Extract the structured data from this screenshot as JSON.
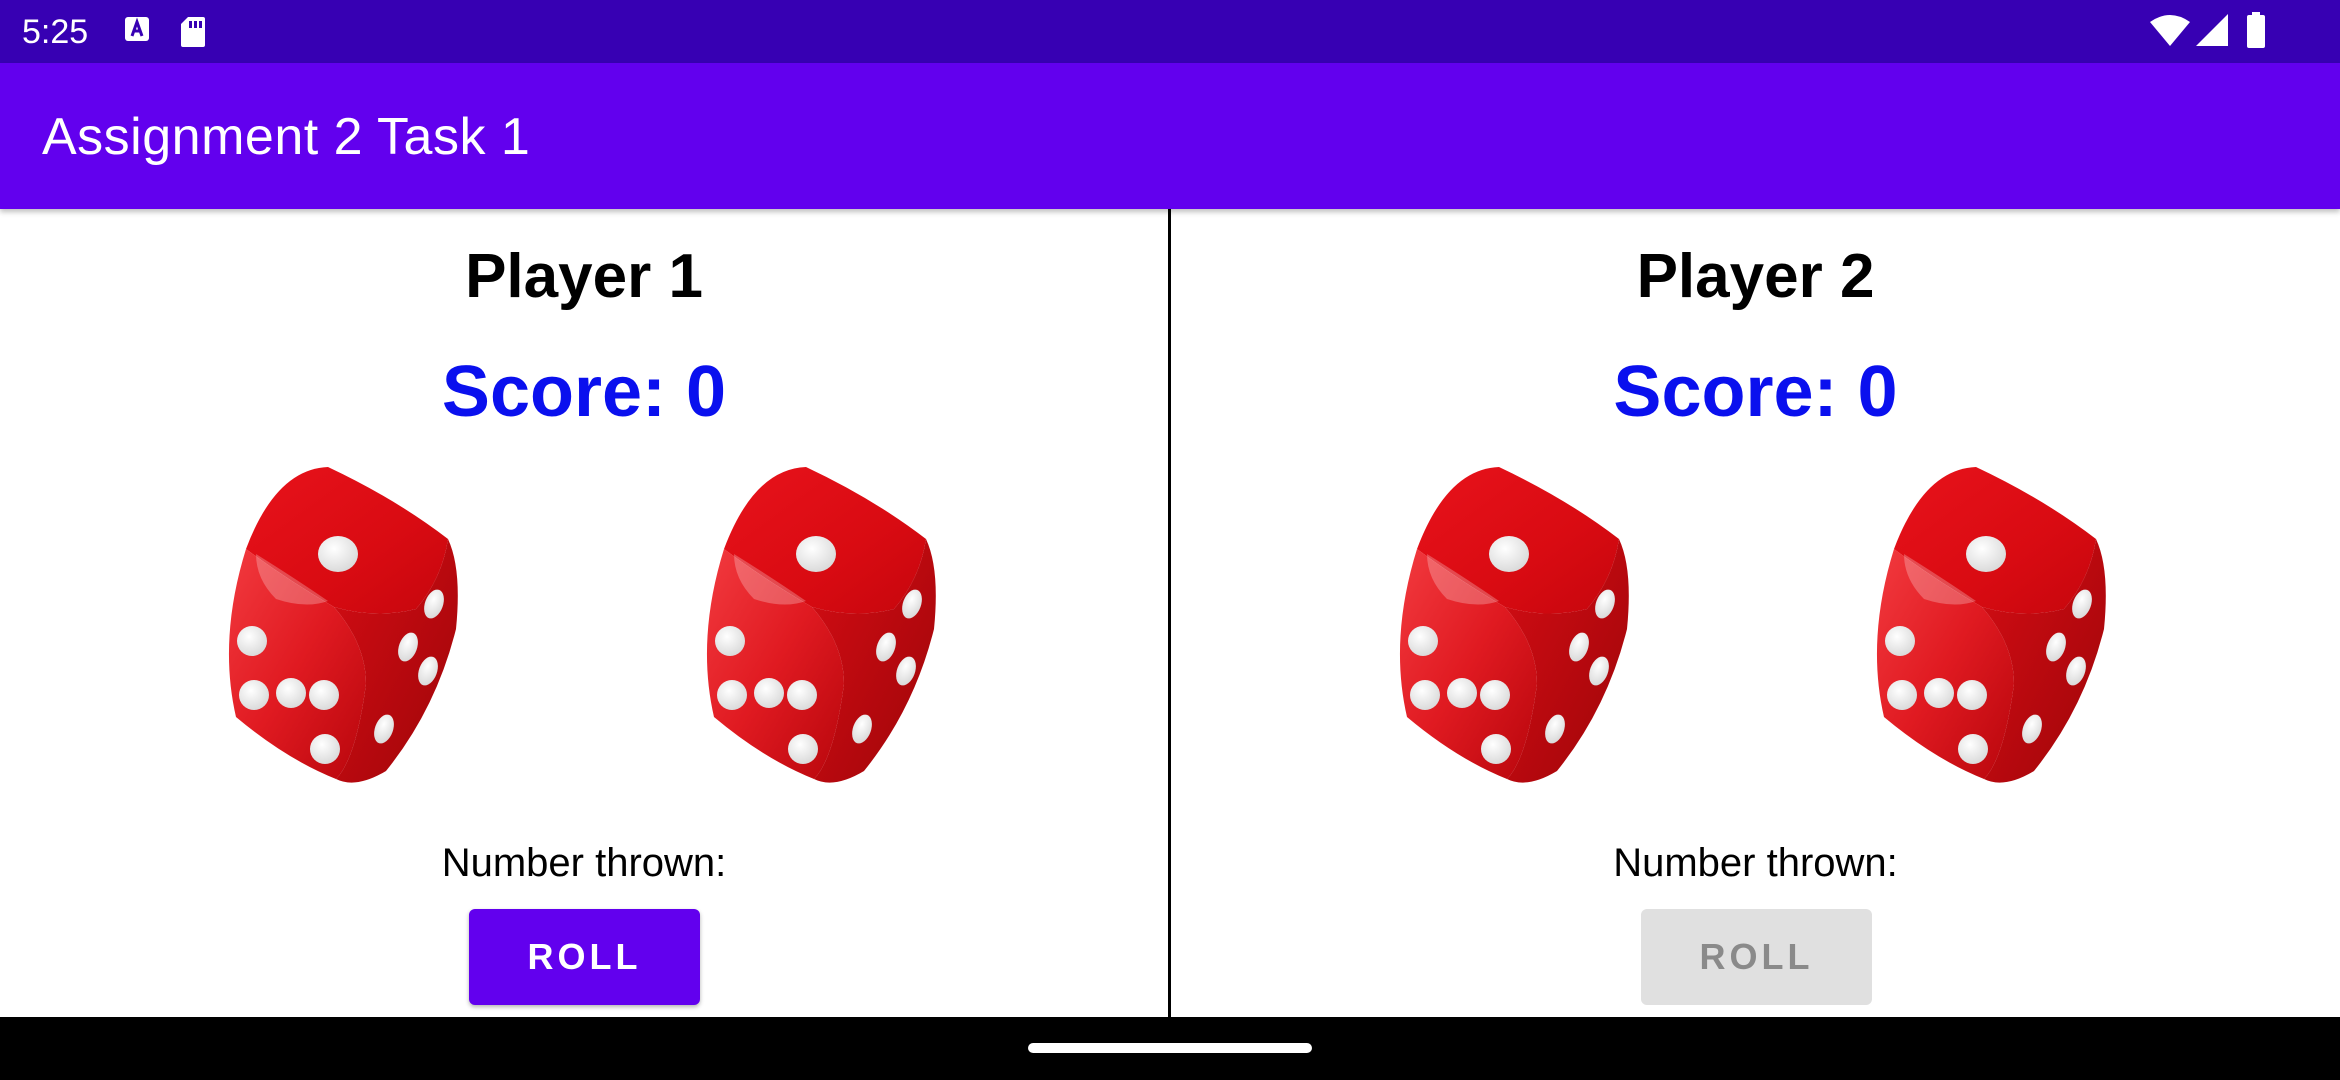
{
  "status_bar": {
    "time": "5:25",
    "left_icons": [
      "accessibility-icon",
      "sd-card-icon"
    ],
    "right_icons": [
      "wifi-icon",
      "signal-icon",
      "battery-icon"
    ]
  },
  "app_bar": {
    "title": "Assignment 2 Task 1"
  },
  "players": [
    {
      "title": "Player 1",
      "score_label": "Score: 0",
      "number_thrown_label": "Number thrown:",
      "roll_label": "ROLL",
      "roll_enabled": true,
      "dice_icons": [
        "red-die-icon",
        "red-die-icon"
      ]
    },
    {
      "title": "Player 2",
      "score_label": "Score: 0",
      "number_thrown_label": "Number thrown:",
      "roll_label": "ROLL",
      "roll_enabled": false,
      "dice_icons": [
        "red-die-icon",
        "red-die-icon"
      ]
    }
  ],
  "colors": {
    "status_bar": "#3700b3",
    "app_bar": "#6200ee",
    "score_text": "#0a10ee",
    "roll_enabled": "#6200ee",
    "roll_disabled": "#e0e0e0"
  }
}
